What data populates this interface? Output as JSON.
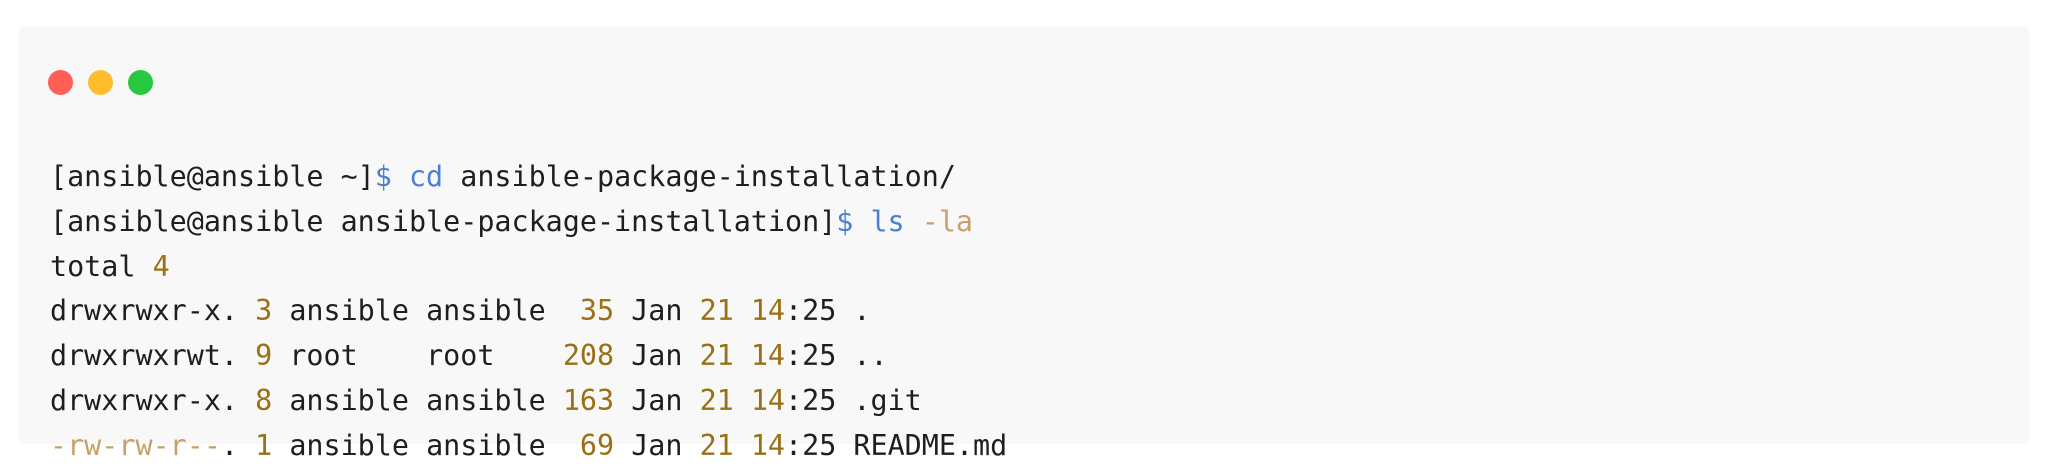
{
  "window": {
    "controls": {
      "close_color": "#ff5f56",
      "minimize_color": "#ffbd2e",
      "maximize_color": "#27c93f"
    }
  },
  "terminal": {
    "line1": {
      "prompt": "[ansible@ansible ~]",
      "dollar": "$",
      "command": "cd",
      "args": "ansible-package-installation/"
    },
    "line2": {
      "prompt": "[ansible@ansible ansible-package-installation]",
      "dollar": "$",
      "command": "ls",
      "flag": "-la"
    },
    "line3": {
      "label": "total",
      "value": "4"
    },
    "rows": [
      {
        "perm": "drwxrwxr-x.",
        "links": "3",
        "owner": "ansible",
        "group": "ansible",
        "size": " 35",
        "month": "Jan",
        "day": "21",
        "hour": "14",
        "min": ":25",
        "name": "."
      },
      {
        "perm": "drwxrwxrwt.",
        "links": "9",
        "owner": "root   ",
        "group": "root   ",
        "size": "208",
        "month": "Jan",
        "day": "21",
        "hour": "14",
        "min": ":25",
        "name": ".."
      },
      {
        "perm": "drwxrwxr-x.",
        "links": "8",
        "owner": "ansible",
        "group": "ansible",
        "size": "163",
        "month": "Jan",
        "day": "21",
        "hour": "14",
        "min": ":25",
        "name": ".git"
      },
      {
        "perm": "-rw-rw-r--",
        "perm_suffix": ".",
        "links": "1",
        "owner": "ansible",
        "group": "ansible",
        "size": " 69",
        "month": "Jan",
        "day": "21",
        "hour": "14",
        "min": ":25",
        "name": "README.md"
      }
    ]
  },
  "colors": {
    "command": "#4a7fd3",
    "flag": "#c9a06b",
    "number": "#9a7015",
    "text": "#1e1e1e",
    "background": "#f8f8f8"
  }
}
